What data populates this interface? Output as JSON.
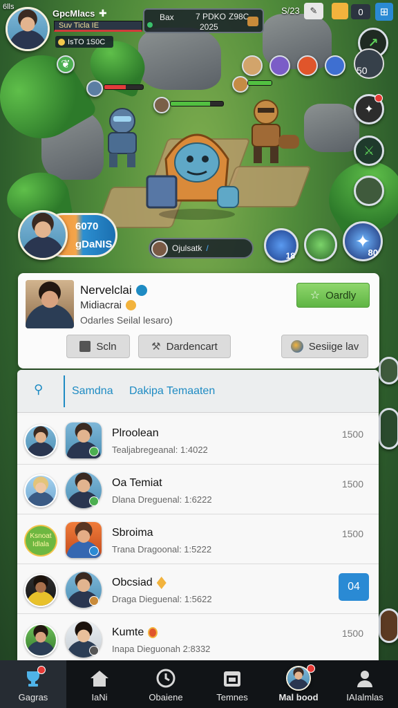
{
  "status_bar": {
    "carrier": "6lls",
    "time": "S/23"
  },
  "hud": {
    "player_name": "GpcMlacs",
    "player_title": "Suv Ticla IE",
    "stat_label": "IsTO 1S0C",
    "resource_box": {
      "label": "Bax",
      "line1": "7 PDKO",
      "line2": "2025",
      "extra": "Z98C"
    },
    "top_right_counter": "0",
    "enemy_level": "50"
  },
  "scene": {
    "player_badge": {
      "value1": "6070",
      "value2": "gDaNIS"
    },
    "action_pill": "Ojulsatk",
    "skill_count_1": "18",
    "skill_count_2": "80"
  },
  "profile": {
    "name": "Nervelclai",
    "subtitle": "Midiacrai",
    "description": "Odarles Seilal lesaro)",
    "primary_button": "Oardly",
    "buttons": {
      "b1": "Scln",
      "b2": "Dardencart",
      "b3": "Sesiige lav"
    }
  },
  "list": {
    "tabs": [
      "Samdna",
      "Dakipa Temaaten"
    ],
    "rows": [
      {
        "name": "Plroolean",
        "sub": "Tealjabregeanal: 1:4022",
        "score": "1500"
      },
      {
        "name": "Oa Temiat",
        "sub": "Dlana Dreguenal: 1:6222",
        "score": "1500"
      },
      {
        "name": "Sbroima",
        "sub": "Trana Dragoonal: 1:5222",
        "score": "1500",
        "tag": "Ksnoat Idlala"
      },
      {
        "name": "Obcsiad",
        "sub": "Draga Dieguenal: 1:5622",
        "score": "04"
      },
      {
        "name": "Kumte",
        "sub": "Inapa Dieguonah 2:8332",
        "score": "1500"
      }
    ]
  },
  "bottom_nav": [
    {
      "label": "Gagras",
      "icon": "trophy-icon"
    },
    {
      "label": "IaNi",
      "icon": "home-icon"
    },
    {
      "label": "Obaiene",
      "icon": "clock-icon"
    },
    {
      "label": "Temnes",
      "icon": "calendar-icon"
    },
    {
      "label": "Mal bood",
      "icon": "avatar-icon"
    },
    {
      "label": "IAIalmlas",
      "icon": "person-icon"
    }
  ],
  "colors": {
    "accent_blue": "#1e8bc3",
    "accent_green": "#6cc04a",
    "nav_bg": "#111417"
  }
}
